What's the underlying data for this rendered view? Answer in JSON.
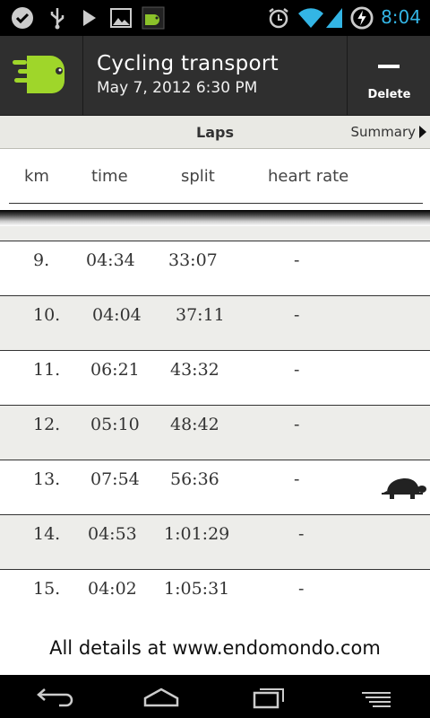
{
  "status_bar": {
    "time": "8:04",
    "icons": [
      "chat-icon",
      "usb-icon",
      "play-icon",
      "image-icon",
      "endomondo-icon",
      "alarm-icon",
      "wifi-icon",
      "signal-icon",
      "battery-icon"
    ]
  },
  "app_bar": {
    "title": "Cycling transport",
    "subtitle": "May 7, 2012 6:30 PM",
    "delete_label": "Delete"
  },
  "tabs": {
    "current": "Laps",
    "next": "Summary"
  },
  "table": {
    "headers": [
      "km",
      "time",
      "split",
      "heart rate"
    ],
    "rows": [
      {
        "km": "9.",
        "time": "04:34",
        "split": "33:07",
        "hr": "-",
        "slowest": false
      },
      {
        "km": "10.",
        "time": "04:04",
        "split": "37:11",
        "hr": "-",
        "slowest": false
      },
      {
        "km": "11.",
        "time": "06:21",
        "split": "43:32",
        "hr": "-",
        "slowest": false
      },
      {
        "km": "12.",
        "time": "05:10",
        "split": "48:42",
        "hr": "-",
        "slowest": false
      },
      {
        "km": "13.",
        "time": "07:54",
        "split": "56:36",
        "hr": "-",
        "slowest": true
      },
      {
        "km": "14.",
        "time": "04:53",
        "split": "1:01:29",
        "hr": "-",
        "slowest": false
      },
      {
        "km": "15.",
        "time": "04:02",
        "split": "1:05:31",
        "hr": "-",
        "slowest": false
      }
    ]
  },
  "footer": {
    "text": "All details at www.endomondo.com"
  },
  "nav_bar": {
    "buttons": [
      "back-icon",
      "home-icon",
      "recent-apps-icon",
      "menu-icon"
    ]
  },
  "colors": {
    "accent_green": "#9fd62a",
    "status_blue": "#33b5e5",
    "app_bar": "#2f2f2f",
    "alt_row": "#ededea"
  }
}
